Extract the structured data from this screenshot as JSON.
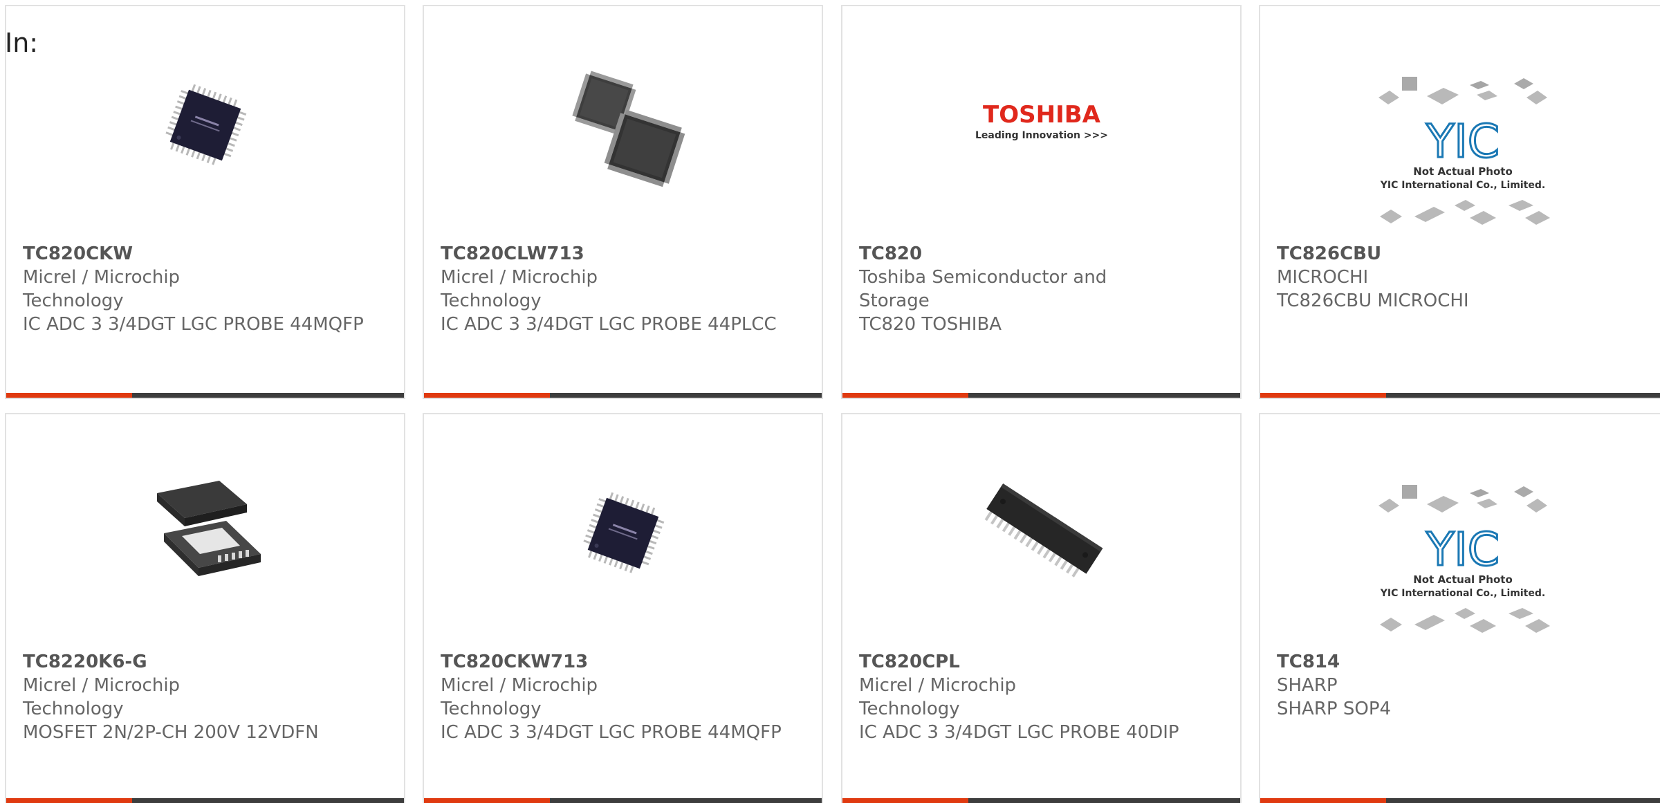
{
  "filter": {
    "label": "In:"
  },
  "colors": {
    "accent": "#e03a10",
    "bar": "#3d3d3d",
    "border": "#e2e2e2",
    "text": "#666666"
  },
  "products": [
    {
      "part": "TC820CKW",
      "manufacturer": "Micrel / Microchip Technology",
      "desc": "IC ADC 3 3/4DGT LGC PROBE 44MQFP",
      "image": "qfp-chip-icon"
    },
    {
      "part": "TC820CLW713",
      "manufacturer": "Micrel / Microchip Technology",
      "desc": "IC ADC 3 3/4DGT LGC PROBE 44PLCC",
      "image": "plcc-chip-icon"
    },
    {
      "part": "TC820",
      "manufacturer": "Toshiba Semiconductor and Storage",
      "desc": "TC820 TOSHIBA",
      "image": "toshiba-logo",
      "logo": {
        "brand": "TOSHIBA",
        "tagline": "Leading Innovation >>>"
      }
    },
    {
      "part": "TC826CBU",
      "manufacturer": "MICROCHI",
      "desc": "TC826CBU MICROCHI",
      "image": "placeholder-photo",
      "placeholder": {
        "mark": "YIC",
        "line1": "Not Actual Photo",
        "line2": "YIC International Co., Limited."
      }
    },
    {
      "part": "TC8220K6-G",
      "manufacturer": "Micrel / Microchip Technology",
      "desc": "MOSFET 2N/2P-CH 200V 12VDFN",
      "image": "dfn-chip-icon"
    },
    {
      "part": "TC820CKW713",
      "manufacturer": "Micrel / Microchip Technology",
      "desc": "IC ADC 3 3/4DGT LGC PROBE 44MQFP",
      "image": "qfp-chip-icon"
    },
    {
      "part": "TC820CPL",
      "manufacturer": "Micrel / Microchip Technology",
      "desc": "IC ADC 3 3/4DGT LGC PROBE 40DIP",
      "image": "dip-chip-icon"
    },
    {
      "part": "TC814",
      "manufacturer": "SHARP",
      "desc": "SHARP SOP4",
      "image": "placeholder-photo",
      "placeholder": {
        "mark": "YIC",
        "line1": "Not Actual Photo",
        "line2": "YIC International Co., Limited."
      }
    }
  ]
}
